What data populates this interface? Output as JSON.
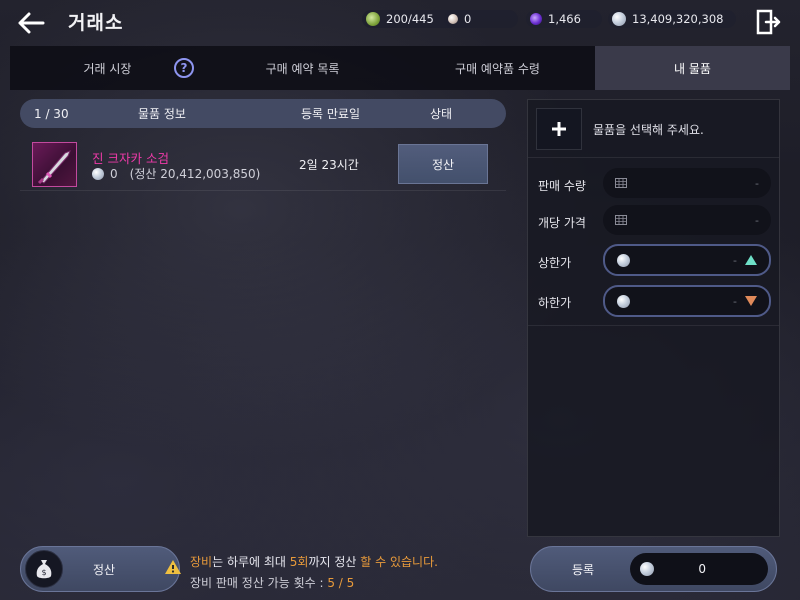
{
  "header": {
    "title": "거래소",
    "currencies": [
      {
        "icon": "energy-icon",
        "value": "200/445"
      },
      {
        "icon": "pearl-icon",
        "value": "0"
      },
      {
        "icon": "crystal-icon",
        "value": "1,466"
      },
      {
        "icon": "silver-icon",
        "value": "13,409,320,308"
      }
    ]
  },
  "tabs": [
    {
      "label": "거래 시장",
      "active": false
    },
    {
      "label": "구매 예약 목록",
      "active": false
    },
    {
      "label": "구매 예약품 수령",
      "active": false
    },
    {
      "label": "내 물품",
      "active": true
    }
  ],
  "table": {
    "count": "1 / 30",
    "col_item": "물품 정보",
    "col_expiry": "등록 만료일",
    "col_status": "상태",
    "rows": [
      {
        "name": "진 크자카 소검",
        "amount": "0",
        "settle_text": "(정산 20,412,003,850)",
        "expiry": "2일 23시간",
        "action": "정산"
      }
    ]
  },
  "panel": {
    "select_prompt": "물품을 선택해 주세요.",
    "fields": [
      {
        "label": "판매 수량",
        "value": "-"
      },
      {
        "label": "개당 가격",
        "value": "-"
      },
      {
        "label": "상한가",
        "value": "-"
      },
      {
        "label": "하한가",
        "value": "-"
      }
    ]
  },
  "bottom": {
    "settle_label": "정산",
    "notice_part1": "장비",
    "notice_part2": "는 하루에 최대 ",
    "notice_part3": "5회",
    "notice_part4": "까지 정산 ",
    "notice_part5": "할 수 있습니다.",
    "count_label": "장비 판매 정산 가능 횟수 : ",
    "count_value": "5 / 5",
    "register_label": "등록",
    "register_amount": "0"
  },
  "colors": {
    "accent": "#4f5a88",
    "item_name": "#ee3aa8",
    "warning": "#e89a3a"
  }
}
